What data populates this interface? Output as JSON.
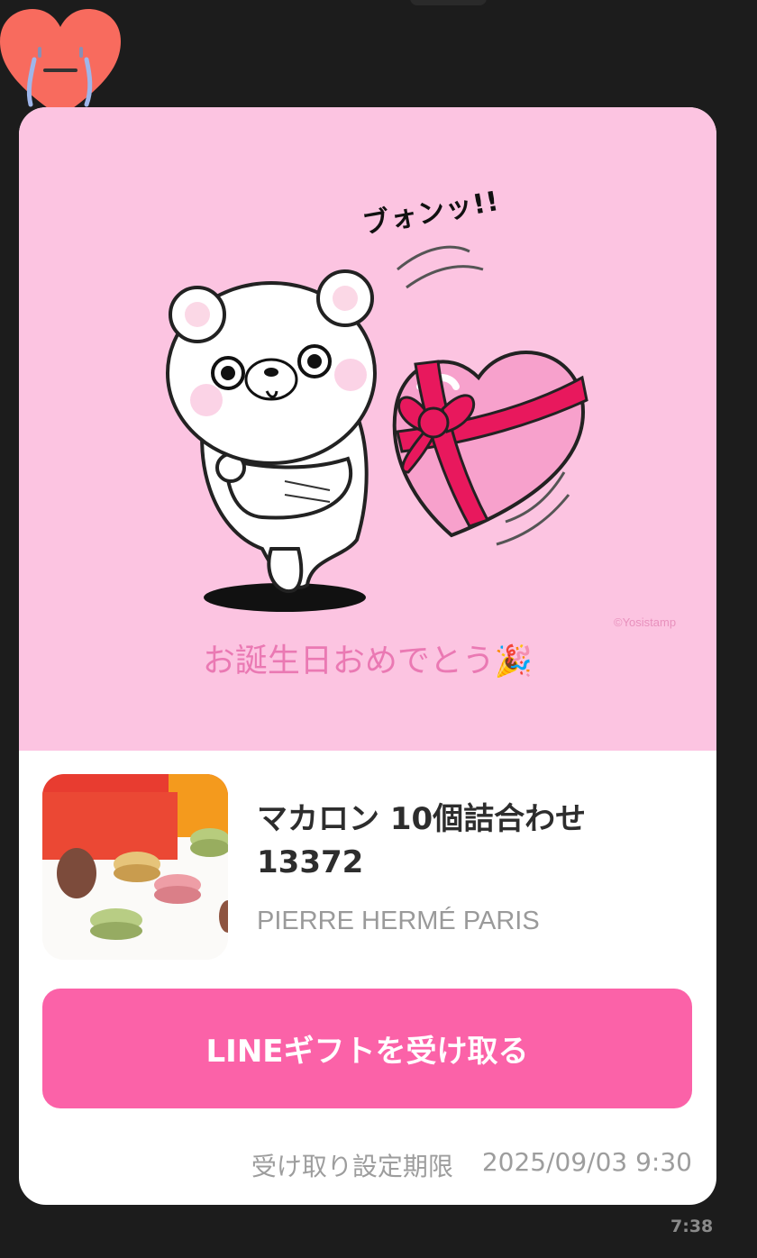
{
  "card": {
    "sticker": {
      "sfx_text": "ブォンッ!!",
      "copyright": "©Yosistamp"
    },
    "message": {
      "text": "お誕生日おめでとう",
      "emoji": "🎉"
    },
    "product": {
      "name_line1": "マカロン 10個詰合わせ",
      "name_line2": "13372",
      "brand": "PIERRE HERMÉ PARIS",
      "thumbnail_icon": "macaron-box-image"
    },
    "receive_button_label": "LINEギフトを受け取る",
    "deadline": {
      "label": "受け取り設定期限",
      "value": "2025/09/03 9:30"
    }
  },
  "message_time": "7:38",
  "reaction": {
    "icon": "crying-heart-icon"
  },
  "colors": {
    "background": "#1c1c1c",
    "banner": "#fcc4e1",
    "message_text": "#ea79b3",
    "button": "#fb62a8",
    "button_text": "#ffffff",
    "secondary_text": "#9d9d9d"
  }
}
